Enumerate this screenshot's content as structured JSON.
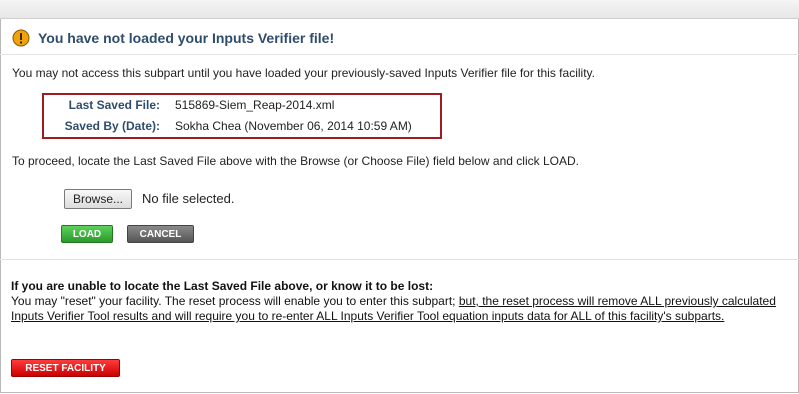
{
  "alert": {
    "title": "You have not loaded your Inputs Verifier file!",
    "icon": "warning-icon",
    "icon_color": "#f0a30a"
  },
  "intro_text": "You may not access this subpart until you have loaded your previously-saved Inputs Verifier file for this facility.",
  "saved_info": {
    "last_saved_label": "Last Saved File:",
    "last_saved_value": "515869-Siem_Reap-2014.xml",
    "saved_by_label": "Saved By (Date):",
    "saved_by_value": "Sokha Chea (November 06, 2014 10:59 AM)",
    "border_color": "#9e1c21"
  },
  "proceed_text": "To proceed, locate the Last Saved File above with the Browse (or Choose File) field below and click LOAD.",
  "file_input": {
    "browse_label": "Browse...",
    "status": "No file selected."
  },
  "buttons": {
    "load": "LOAD",
    "cancel": "CANCEL",
    "reset": "RESET FACILITY"
  },
  "lost_section": {
    "heading": "If you are unable to locate the Last Saved File above, or know it to be lost:",
    "body_plain": "You may \"reset\" your facility. The reset process will enable you to enter this subpart; ",
    "body_underlined": "but, the reset process will remove ALL previously calculated Inputs Verifier Tool results and will require you to re-enter ALL Inputs Verifier Tool equation inputs data for ALL of this facility's subparts."
  },
  "colors": {
    "title": "#2f4d6b",
    "load": "#2a9a2a",
    "cancel": "#555555",
    "reset": "#cc0000"
  }
}
